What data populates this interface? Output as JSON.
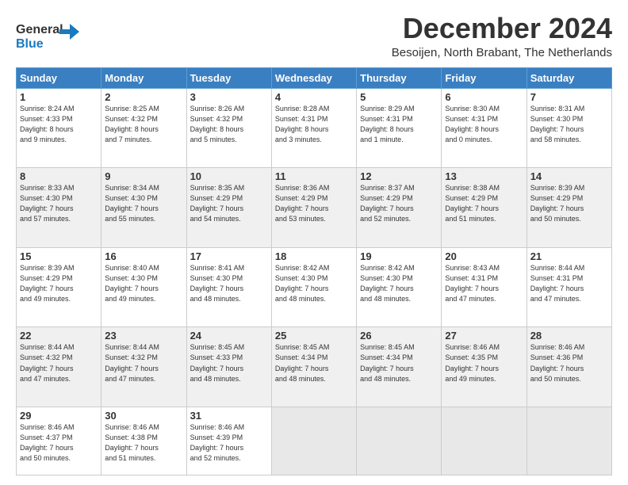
{
  "header": {
    "logo_line1": "General",
    "logo_line2": "Blue",
    "month": "December 2024",
    "location": "Besoijen, North Brabant, The Netherlands"
  },
  "days_of_week": [
    "Sunday",
    "Monday",
    "Tuesday",
    "Wednesday",
    "Thursday",
    "Friday",
    "Saturday"
  ],
  "weeks": [
    [
      {
        "day": 1,
        "info": "Sunrise: 8:24 AM\nSunset: 4:33 PM\nDaylight: 8 hours\nand 9 minutes."
      },
      {
        "day": 2,
        "info": "Sunrise: 8:25 AM\nSunset: 4:32 PM\nDaylight: 8 hours\nand 7 minutes."
      },
      {
        "day": 3,
        "info": "Sunrise: 8:26 AM\nSunset: 4:32 PM\nDaylight: 8 hours\nand 5 minutes."
      },
      {
        "day": 4,
        "info": "Sunrise: 8:28 AM\nSunset: 4:31 PM\nDaylight: 8 hours\nand 3 minutes."
      },
      {
        "day": 5,
        "info": "Sunrise: 8:29 AM\nSunset: 4:31 PM\nDaylight: 8 hours\nand 1 minute."
      },
      {
        "day": 6,
        "info": "Sunrise: 8:30 AM\nSunset: 4:31 PM\nDaylight: 8 hours\nand 0 minutes."
      },
      {
        "day": 7,
        "info": "Sunrise: 8:31 AM\nSunset: 4:30 PM\nDaylight: 7 hours\nand 58 minutes."
      }
    ],
    [
      {
        "day": 8,
        "info": "Sunrise: 8:33 AM\nSunset: 4:30 PM\nDaylight: 7 hours\nand 57 minutes."
      },
      {
        "day": 9,
        "info": "Sunrise: 8:34 AM\nSunset: 4:30 PM\nDaylight: 7 hours\nand 55 minutes."
      },
      {
        "day": 10,
        "info": "Sunrise: 8:35 AM\nSunset: 4:29 PM\nDaylight: 7 hours\nand 54 minutes."
      },
      {
        "day": 11,
        "info": "Sunrise: 8:36 AM\nSunset: 4:29 PM\nDaylight: 7 hours\nand 53 minutes."
      },
      {
        "day": 12,
        "info": "Sunrise: 8:37 AM\nSunset: 4:29 PM\nDaylight: 7 hours\nand 52 minutes."
      },
      {
        "day": 13,
        "info": "Sunrise: 8:38 AM\nSunset: 4:29 PM\nDaylight: 7 hours\nand 51 minutes."
      },
      {
        "day": 14,
        "info": "Sunrise: 8:39 AM\nSunset: 4:29 PM\nDaylight: 7 hours\nand 50 minutes."
      }
    ],
    [
      {
        "day": 15,
        "info": "Sunrise: 8:39 AM\nSunset: 4:29 PM\nDaylight: 7 hours\nand 49 minutes."
      },
      {
        "day": 16,
        "info": "Sunrise: 8:40 AM\nSunset: 4:30 PM\nDaylight: 7 hours\nand 49 minutes."
      },
      {
        "day": 17,
        "info": "Sunrise: 8:41 AM\nSunset: 4:30 PM\nDaylight: 7 hours\nand 48 minutes."
      },
      {
        "day": 18,
        "info": "Sunrise: 8:42 AM\nSunset: 4:30 PM\nDaylight: 7 hours\nand 48 minutes."
      },
      {
        "day": 19,
        "info": "Sunrise: 8:42 AM\nSunset: 4:30 PM\nDaylight: 7 hours\nand 48 minutes."
      },
      {
        "day": 20,
        "info": "Sunrise: 8:43 AM\nSunset: 4:31 PM\nDaylight: 7 hours\nand 47 minutes."
      },
      {
        "day": 21,
        "info": "Sunrise: 8:44 AM\nSunset: 4:31 PM\nDaylight: 7 hours\nand 47 minutes."
      }
    ],
    [
      {
        "day": 22,
        "info": "Sunrise: 8:44 AM\nSunset: 4:32 PM\nDaylight: 7 hours\nand 47 minutes."
      },
      {
        "day": 23,
        "info": "Sunrise: 8:44 AM\nSunset: 4:32 PM\nDaylight: 7 hours\nand 47 minutes."
      },
      {
        "day": 24,
        "info": "Sunrise: 8:45 AM\nSunset: 4:33 PM\nDaylight: 7 hours\nand 48 minutes."
      },
      {
        "day": 25,
        "info": "Sunrise: 8:45 AM\nSunset: 4:34 PM\nDaylight: 7 hours\nand 48 minutes."
      },
      {
        "day": 26,
        "info": "Sunrise: 8:45 AM\nSunset: 4:34 PM\nDaylight: 7 hours\nand 48 minutes."
      },
      {
        "day": 27,
        "info": "Sunrise: 8:46 AM\nSunset: 4:35 PM\nDaylight: 7 hours\nand 49 minutes."
      },
      {
        "day": 28,
        "info": "Sunrise: 8:46 AM\nSunset: 4:36 PM\nDaylight: 7 hours\nand 50 minutes."
      }
    ],
    [
      {
        "day": 29,
        "info": "Sunrise: 8:46 AM\nSunset: 4:37 PM\nDaylight: 7 hours\nand 50 minutes."
      },
      {
        "day": 30,
        "info": "Sunrise: 8:46 AM\nSunset: 4:38 PM\nDaylight: 7 hours\nand 51 minutes."
      },
      {
        "day": 31,
        "info": "Sunrise: 8:46 AM\nSunset: 4:39 PM\nDaylight: 7 hours\nand 52 minutes."
      },
      null,
      null,
      null,
      null
    ]
  ]
}
